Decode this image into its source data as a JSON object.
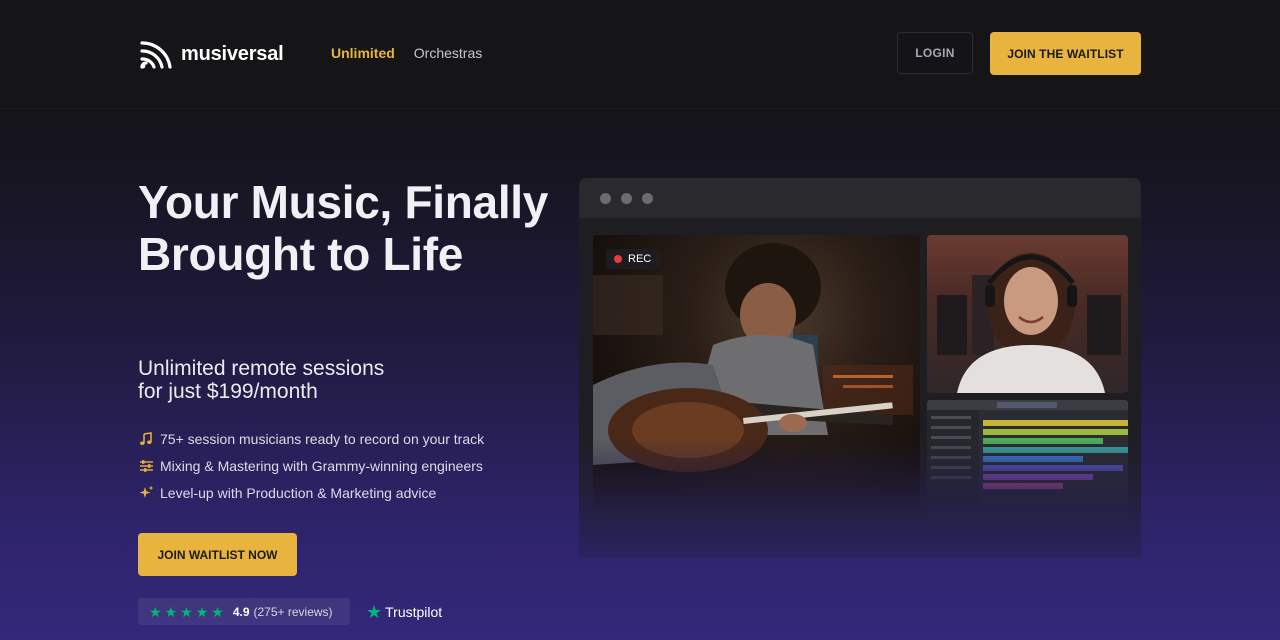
{
  "header": {
    "logo_text": "musiversal",
    "nav": [
      {
        "label": "Unlimited",
        "active": true
      },
      {
        "label": "Orchestras",
        "active": false
      }
    ],
    "login_label": "LOGIN",
    "waitlist_label": "JOIN THE WAITLIST"
  },
  "hero": {
    "title": "Your Music, Finally Brought to Life",
    "subtitle_line1": "Unlimited remote sessions",
    "subtitle_line2": "for just $199/month",
    "features": [
      {
        "icon": "music-note-icon",
        "text": "75+ session musicians ready to record on your track"
      },
      {
        "icon": "sliders-icon",
        "text": "Mixing & Mastering with Grammy-winning engineers"
      },
      {
        "icon": "sparkle-icon",
        "text": "Level-up with Production & Marketing advice"
      }
    ],
    "cta_label": "JOIN WAITLIST NOW",
    "rating": {
      "score": "4.9",
      "reviews": "(275+ reviews)",
      "stars": 5,
      "provider": "Trustpilot"
    }
  },
  "preview": {
    "rec_label": "REC"
  },
  "colors": {
    "accent": "#e8b43e",
    "active_nav": "#e9b33f",
    "trustpilot_green": "#00b67a",
    "rec_red": "#e33c3c"
  }
}
